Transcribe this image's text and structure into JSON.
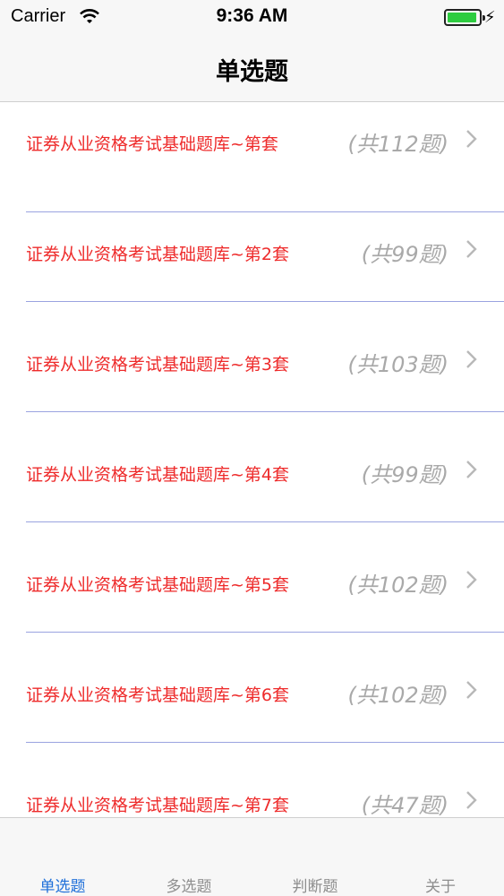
{
  "status_bar": {
    "carrier": "Carrier",
    "time": "9:36 AM",
    "battery_color": "#2ecc40"
  },
  "nav": {
    "title": "单选题"
  },
  "list": {
    "items": [
      {
        "label": "证券从业资格考试基础题库~第套",
        "count": "(共112题)"
      },
      {
        "label": "证券从业资格考试基础题库~第2套",
        "count": "(共99题)"
      },
      {
        "label": "证券从业资格考试基础题库~第3套",
        "count": "(共103题)"
      },
      {
        "label": "证券从业资格考试基础题库~第4套",
        "count": "(共99题)"
      },
      {
        "label": "证券从业资格考试基础题库~第5套",
        "count": "(共102题)"
      },
      {
        "label": "证券从业资格考试基础题库~第6套",
        "count": "(共102题)"
      },
      {
        "label": "证券从业资格考试基础题库~第7套",
        "count": "(共47题)"
      }
    ]
  },
  "tab_bar": {
    "tabs": [
      {
        "label": "单选题",
        "active": true
      },
      {
        "label": "多选题",
        "active": false
      },
      {
        "label": "判断题",
        "active": false
      },
      {
        "label": "关于",
        "active": false
      }
    ],
    "active_color": "#1e6fd9"
  },
  "colors": {
    "label": "#ee2b2b",
    "count": "#a9a9a9",
    "separator": "#9aa3e0"
  }
}
